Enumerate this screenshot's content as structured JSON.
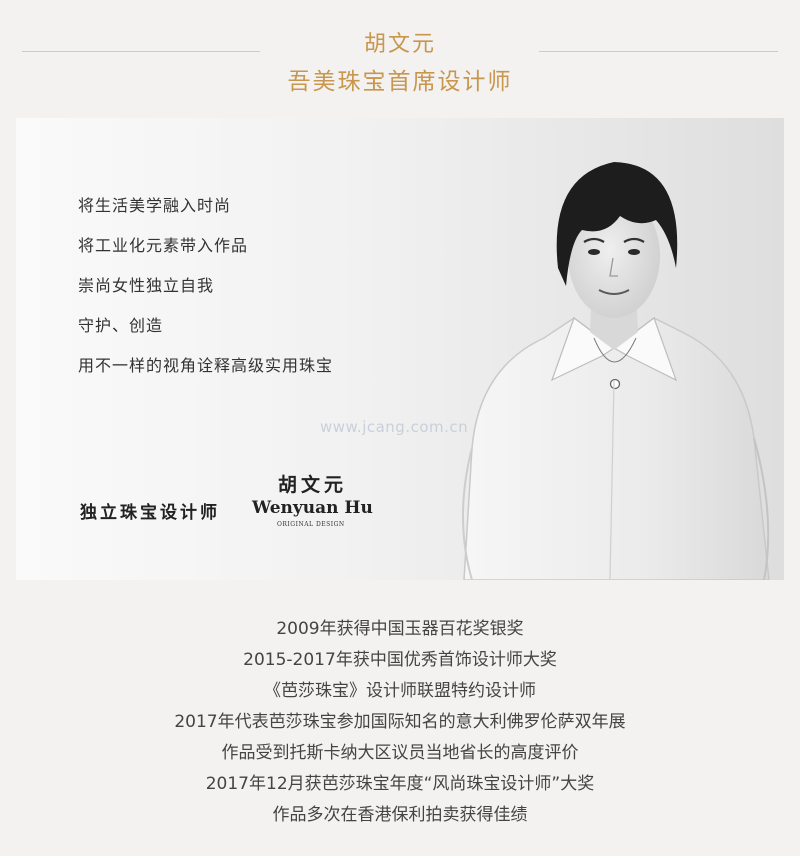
{
  "header": {
    "name": "胡文元",
    "role": "吾美珠宝首席设计师"
  },
  "panel": {
    "mottos": [
      "将生活美学融入时尚",
      "将工业化元素带入作品",
      "崇尚女性独立自我",
      "守护、创造",
      "用不一样的视角诠释高级实用珠宝"
    ],
    "watermark": "www.jcang.com.cn",
    "brand_cn": "独立珠宝设计师",
    "signature_cn": "胡文元",
    "signature_en": "Wenyuan Hu",
    "signature_sub": "ORIGINAL DESIGN"
  },
  "achievements": [
    "2009年获得中国玉器百花奖银奖",
    "2015-2017年获中国优秀首饰设计师大奖",
    "《芭莎珠宝》设计师联盟特约设计师",
    "2017年代表芭莎珠宝参加国际知名的意大利佛罗伦萨双年展",
    "作品受到托斯卡纳大区议员当地省长的高度评价",
    "2017年12月获芭莎珠宝年度“风尚珠宝设计师”大奖",
    "作品多次在香港保利拍卖获得佳绩"
  ],
  "colors": {
    "accent": "#c8964c",
    "background": "#f3f2f0"
  }
}
